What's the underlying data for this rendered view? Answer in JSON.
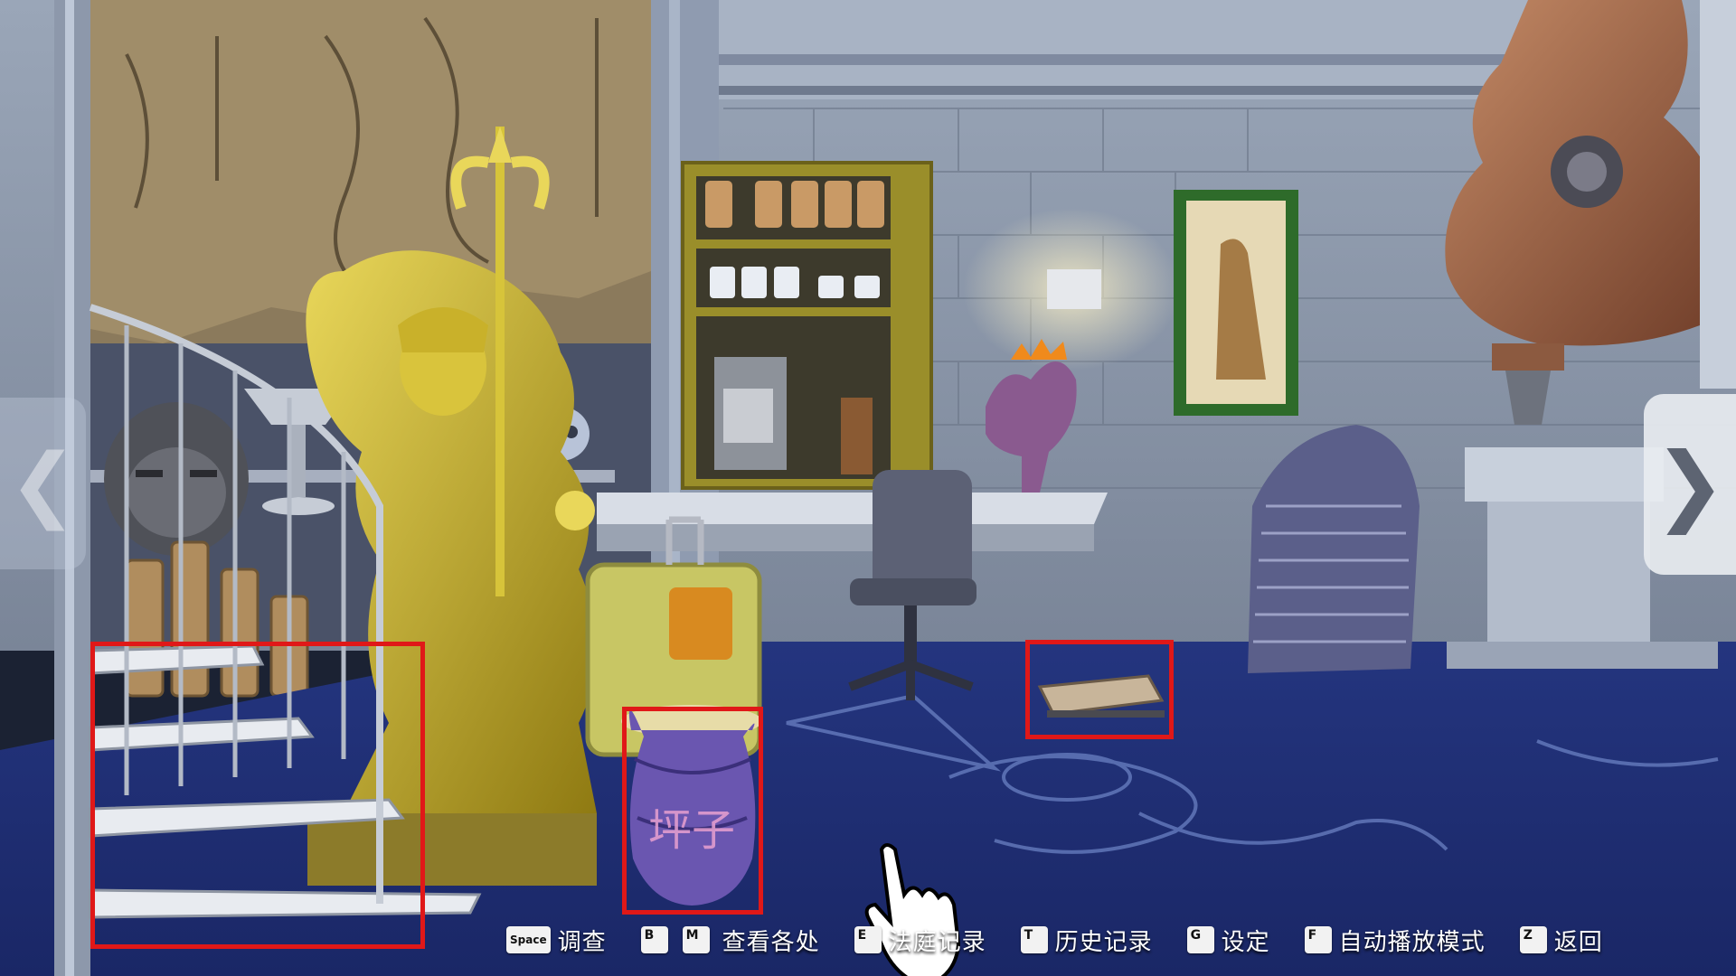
{
  "scene": {
    "name": "Exhibit room",
    "colors": {
      "wall": "#8a96aa",
      "carpet": "#1f2f78",
      "gold": "#c9b12a",
      "highlight": "#e01818"
    }
  },
  "objects": [
    {
      "name": "spiral-staircase",
      "highlighted": true
    },
    {
      "name": "tsubo-jar",
      "highlighted": true,
      "label": "坪子"
    },
    {
      "name": "notebook-on-floor",
      "highlighted": true
    }
  ],
  "nav": {
    "left_arrow": "❮",
    "right_arrow": "❯"
  },
  "hud": {
    "items": [
      {
        "keys": [
          "Space"
        ],
        "label": "调查"
      },
      {
        "keys": [
          "B",
          "M"
        ],
        "label": "查看各处"
      },
      {
        "keys": [
          "E"
        ],
        "label": "法庭记录"
      },
      {
        "keys": [
          "T"
        ],
        "label": "历史记录"
      },
      {
        "keys": [
          "G"
        ],
        "label": "设定"
      },
      {
        "keys": [
          "F"
        ],
        "label": "自动播放模式"
      },
      {
        "keys": [
          "Z"
        ],
        "label": "返回"
      }
    ]
  }
}
